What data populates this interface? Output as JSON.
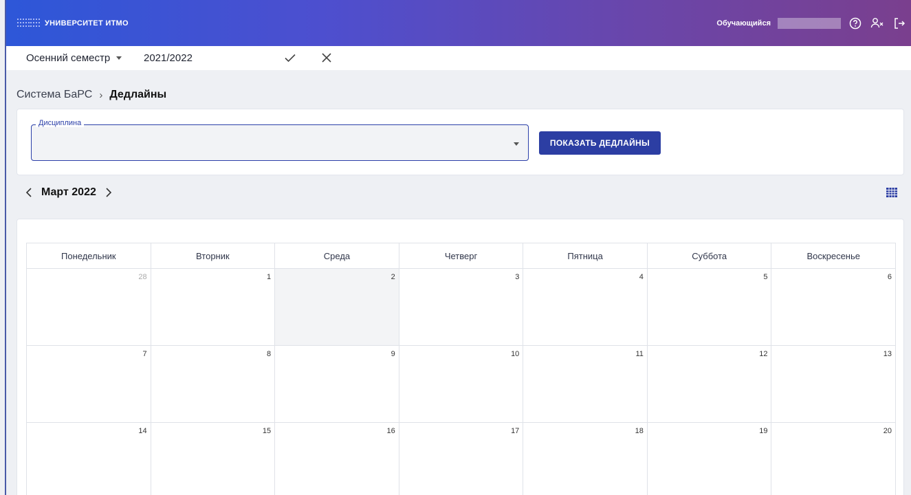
{
  "header": {
    "logo_text": "УНИВЕРСИТЕТ ИТМО",
    "role": "Обучающийся",
    "icons": [
      "help-icon",
      "user-switch-icon",
      "logout-icon"
    ]
  },
  "semester": {
    "selected": "Осенний семестр",
    "year": "2021/2022"
  },
  "breadcrumb": {
    "root": "Система БаРС",
    "separator": "›",
    "current": "Дедлайны"
  },
  "filter": {
    "field_label": "Дисциплина",
    "field_value": "",
    "button_label": "ПОКАЗАТЬ ДЕДЛАЙНЫ"
  },
  "calendar": {
    "month_label": "Март 2022",
    "weekdays": [
      "Понедельник",
      "Вторник",
      "Среда",
      "Четверг",
      "Пятница",
      "Суббота",
      "Воскресенье"
    ],
    "weeks": [
      [
        {
          "d": "28",
          "other": true
        },
        {
          "d": "1"
        },
        {
          "d": "2",
          "today": true
        },
        {
          "d": "3"
        },
        {
          "d": "4"
        },
        {
          "d": "5"
        },
        {
          "d": "6"
        }
      ],
      [
        {
          "d": "7"
        },
        {
          "d": "8"
        },
        {
          "d": "9"
        },
        {
          "d": "10"
        },
        {
          "d": "11"
        },
        {
          "d": "12"
        },
        {
          "d": "13"
        }
      ],
      [
        {
          "d": "14"
        },
        {
          "d": "15"
        },
        {
          "d": "16"
        },
        {
          "d": "17"
        },
        {
          "d": "18"
        },
        {
          "d": "19"
        },
        {
          "d": "20"
        }
      ]
    ]
  },
  "colors": {
    "accent": "#2c3ea3",
    "header_gradient_start": "#2d57d8",
    "header_gradient_end": "#7a3f8e",
    "today_bg": "#f3f4f6"
  }
}
